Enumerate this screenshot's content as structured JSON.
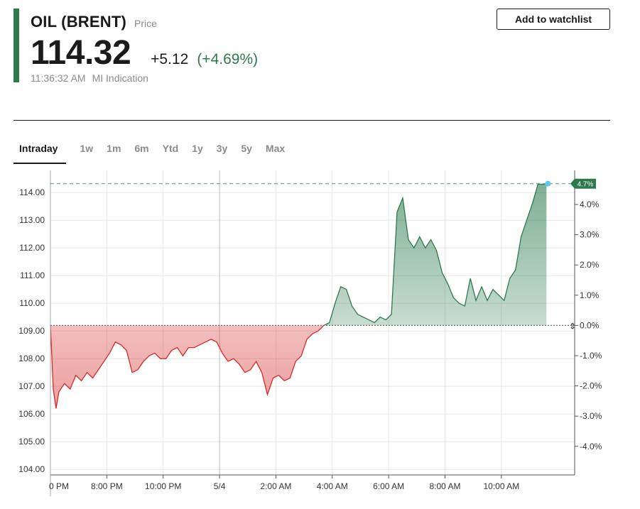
{
  "instrument": {
    "name": "OIL (BRENT)",
    "sub_label": "Price",
    "price": "114.32",
    "change": "+5.12",
    "change_pct": "(+4.69%)",
    "time": "11:36:32 AM",
    "source": "MI Indication"
  },
  "actions": {
    "watchlist_label": "Add to watchlist"
  },
  "tabs": [
    {
      "label": "Intraday",
      "active": true
    },
    {
      "label": "1w",
      "active": false
    },
    {
      "label": "1m",
      "active": false
    },
    {
      "label": "6m",
      "active": false
    },
    {
      "label": "Ytd",
      "active": false
    },
    {
      "label": "1y",
      "active": false
    },
    {
      "label": "3y",
      "active": false
    },
    {
      "label": "5y",
      "active": false
    },
    {
      "label": "Max",
      "active": false
    }
  ],
  "colors": {
    "accent": "#2b7a4b",
    "positive": "#2b7a4b",
    "negative": "#d42a2a",
    "grid": "#e6e6e6",
    "marker": "#5bc8f5"
  },
  "chart_data": {
    "type": "area",
    "baseline": 109.2,
    "current_pct_label": "4.7%",
    "y_ticks": [
      "114.00",
      "113.00",
      "112.00",
      "111.00",
      "110.00",
      "109.00",
      "108.00",
      "107.00",
      "106.00",
      "105.00",
      "104.00"
    ],
    "y_pct_ticks": [
      "4.0%",
      "3.0%",
      "2.0%",
      "1.0%",
      "0.0%",
      "-1.0%",
      "-2.0%",
      "-3.0%",
      "-4.0%"
    ],
    "x_ticks": [
      "0 PM",
      "8:00 PM",
      "10:00 PM",
      "5/4",
      "2:00 AM",
      "4:00 AM",
      "6:00 AM",
      "8:00 AM",
      "10:00 AM"
    ],
    "ylim": [
      103.8,
      114.8
    ],
    "x_hours": [
      18.0,
      18.1,
      18.2,
      18.3,
      18.5,
      18.7,
      18.9,
      19.1,
      19.3,
      19.5,
      19.7,
      19.9,
      20.1,
      20.3,
      20.5,
      20.7,
      20.9,
      21.1,
      21.3,
      21.5,
      21.7,
      21.9,
      22.1,
      22.3,
      22.5,
      22.7,
      22.9,
      23.1,
      23.3,
      23.5,
      23.7,
      23.9,
      24.1,
      24.3,
      24.5,
      24.7,
      24.9,
      25.1,
      25.3,
      25.5,
      25.7,
      25.9,
      26.1,
      26.3,
      26.5,
      26.7,
      26.9,
      27.1,
      27.3,
      27.5,
      27.7,
      27.9,
      28.1,
      28.3,
      28.5,
      28.7,
      28.9,
      29.1,
      29.3,
      29.5,
      29.7,
      29.9,
      30.1,
      30.3,
      30.5,
      30.7,
      30.9,
      31.1,
      31.3,
      31.5,
      31.7,
      31.9,
      32.1,
      32.3,
      32.5,
      32.7,
      32.9,
      33.1,
      33.3,
      33.5,
      33.7,
      33.9,
      34.1,
      34.3,
      34.5,
      34.7,
      34.9,
      35.1,
      35.3,
      35.5,
      35.6
    ],
    "y_values": [
      109.2,
      106.9,
      106.2,
      106.8,
      107.1,
      106.9,
      107.4,
      107.2,
      107.5,
      107.3,
      107.6,
      107.9,
      108.2,
      108.6,
      108.5,
      108.3,
      107.5,
      107.6,
      107.9,
      108.1,
      108.2,
      108.0,
      108.0,
      108.3,
      108.4,
      108.1,
      108.4,
      108.4,
      108.5,
      108.6,
      108.7,
      108.6,
      108.2,
      107.9,
      108.0,
      107.8,
      107.5,
      107.6,
      107.9,
      107.5,
      106.7,
      107.3,
      107.4,
      107.2,
      107.3,
      107.9,
      108.1,
      108.7,
      108.9,
      109.0,
      109.2,
      109.3,
      110.0,
      110.6,
      110.5,
      109.9,
      109.6,
      109.5,
      109.4,
      109.3,
      109.5,
      109.4,
      109.6,
      113.3,
      113.8,
      112.3,
      112.0,
      112.4,
      112.0,
      112.3,
      111.9,
      111.1,
      110.7,
      110.2,
      110.0,
      109.9,
      110.9,
      110.1,
      110.6,
      110.1,
      110.5,
      110.3,
      110.1,
      110.9,
      111.2,
      112.4,
      113.0,
      113.6,
      114.3,
      114.3,
      114.32
    ]
  }
}
